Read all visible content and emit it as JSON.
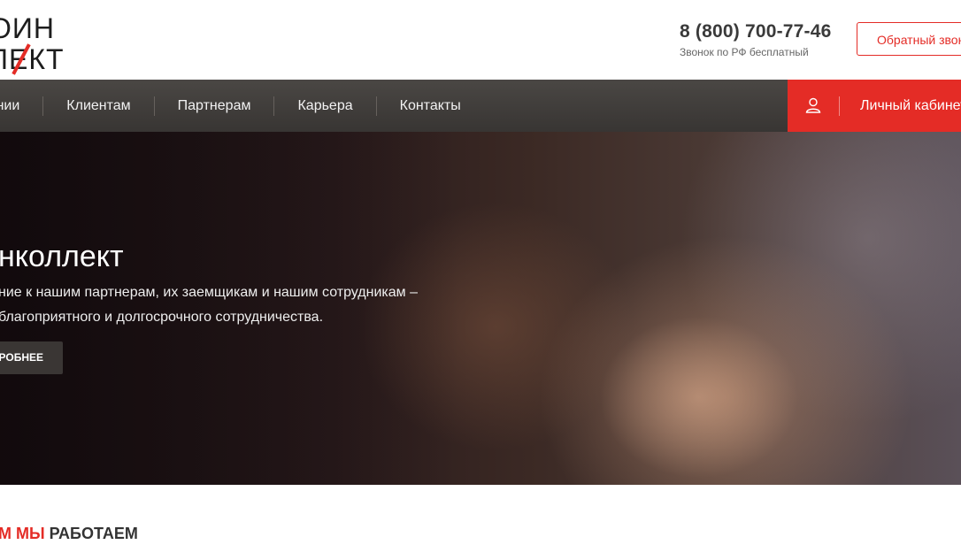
{
  "header": {
    "logo": {
      "line1": "ОИН",
      "line2": "ЛЕКТ"
    },
    "phone": {
      "number": "8 (800) 700-77-46",
      "note": "Звонок по РФ бесплатный"
    },
    "callback_label": "Обратный звонок"
  },
  "nav": {
    "items": [
      {
        "label": "пании"
      },
      {
        "label": "Клиентам"
      },
      {
        "label": "Партнерам"
      },
      {
        "label": "Карьера"
      },
      {
        "label": "Контакты"
      }
    ],
    "cabinet": {
      "icon": "user-icon",
      "label": "Личный кабинет"
    }
  },
  "hero": {
    "title": "нколлект",
    "text": "ние к нашим партнерам, их заемщикам и нашим сотрудникам – благоприятного и долгосрочного сотрудничества.",
    "button_label": "ДРОБНЕЕ"
  },
  "section": {
    "heading_red": "М МЫ",
    "heading_dark": " РАБОТАЕМ"
  },
  "colors": {
    "accent": "#e42c26",
    "nav_bg": "#403d3b",
    "button_dark": "#3a3634"
  }
}
